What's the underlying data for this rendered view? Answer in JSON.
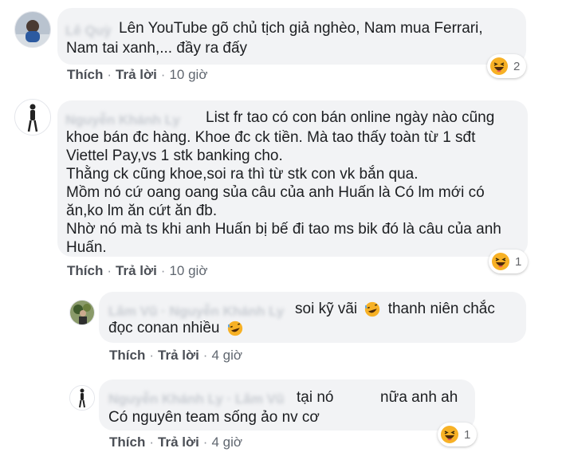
{
  "comments": [
    {
      "lines": [
        "Lên YouTube gõ chủ tịch giả nghèo, Nam mua Ferrari,",
        "Nam tai xanh,... đầy ra đấy"
      ],
      "actions": {
        "like": "Thích",
        "reply": "Trả lời",
        "time": "10 giờ"
      },
      "reaction": {
        "icon": "haha-icon",
        "count": "2"
      }
    },
    {
      "lines": [
        "List fr tao có con bán online ngày nào cũng",
        "khoe bán đc hàng. Khoe đc ck tiền. Mà tao thấy toàn từ 1 sđt",
        "Viettel Pay,vs 1 stk banking cho.",
        "Thằng ck cũng khoe,soi ra thì từ stk con vk bắn qua.",
        "Mồm nó cứ oang oang sủa câu của anh Huấn là Có lm mới có",
        "ăn,ko lm ăn cứt ăn đb.",
        "Nhờ nó mà ts khi anh Huấn bị bế đi tao ms bik đó là câu của anh",
        "Huấn."
      ],
      "actions": {
        "like": "Thích",
        "reply": "Trả lời",
        "time": "10 giờ"
      },
      "reaction": {
        "icon": "haha-icon",
        "count": "1"
      }
    }
  ],
  "replies": [
    {
      "line1_a": "soi kỹ vãi",
      "line1_b": "thanh niên chắc",
      "line2": "đọc conan nhiều",
      "emoji": "rofl-icon",
      "actions": {
        "like": "Thích",
        "reply": "Trả lời",
        "time": "4 giờ"
      }
    },
    {
      "line1_a": "tại nó",
      "line1_b": "nữa anh ah",
      "line2": "Có nguyên team sống ảo nv cơ",
      "actions": {
        "like": "Thích",
        "reply": "Trả lời",
        "time": "4 giờ"
      },
      "reaction": {
        "icon": "haha-icon",
        "count": "1"
      }
    }
  ],
  "colors": {
    "bubble": "#f2f3f5",
    "link": "#4b4f56",
    "meta": "#65676b",
    "haha": "#f7b125"
  }
}
